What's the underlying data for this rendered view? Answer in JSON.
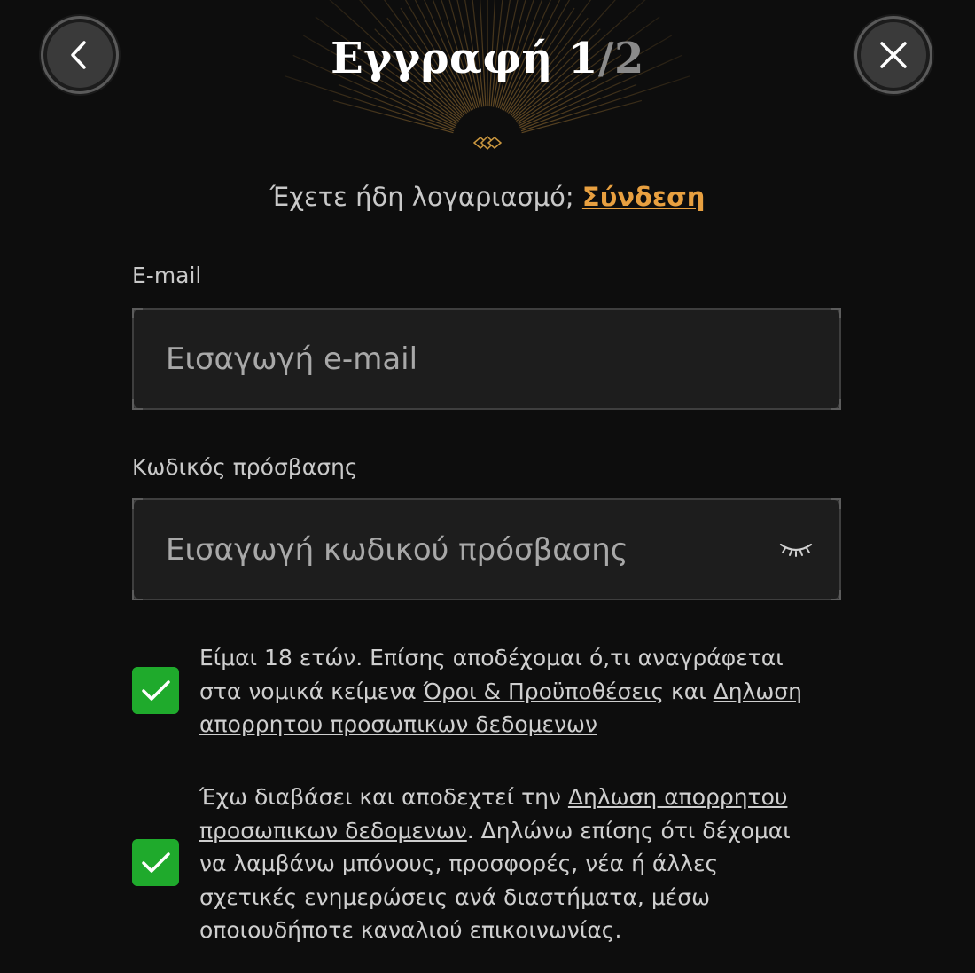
{
  "header": {
    "title": "Εγγραφή",
    "step_current": "1",
    "step_separator": "/",
    "step_total": "2",
    "back_icon": "chevron-left-icon",
    "close_icon": "close-icon"
  },
  "login_prompt": {
    "text": "Έχετε ήδη λογαριασμό; ",
    "link": "Σύνδεση"
  },
  "form": {
    "email": {
      "label": "E-mail",
      "placeholder": "Εισαγωγή e-mail",
      "value": ""
    },
    "password": {
      "label": "Κωδικός πρόσβασης",
      "placeholder": "Εισαγωγή κωδικού πρόσβασης",
      "value": "",
      "toggle_icon": "eye-closed-icon"
    }
  },
  "consents": [
    {
      "checked": true,
      "text_1": "Είμαι 18 ετών. Επίσης αποδέχομαι ό,τι αναγράφεται στα νομικά κείμενα ",
      "link_1": "Όροι & Προϋποθέσεις",
      "text_2": " και ",
      "link_2": "Δηλωση απορρητου προσωπικων δεδομενων"
    },
    {
      "checked": true,
      "text_1": "Έχω διαβάσει και αποδεχτεί την ",
      "link_1": "Δηλωση απορρητου προσωπικων δεδομενων",
      "text_2": ". Δηλώνω επίσης ότι δέχομαι να λαμβάνω μπόνους, προσφορές, νέα ή άλλες σχετικές ενημερώσεις ανά διαστήματα, μέσω οποιουδήποτε καναλιού επικοινωνίας."
    }
  ],
  "colors": {
    "background": "#0d0d0d",
    "accent_link": "#e8a040",
    "checkbox": "#1faa2c",
    "gold_divider": "#b8863a"
  }
}
